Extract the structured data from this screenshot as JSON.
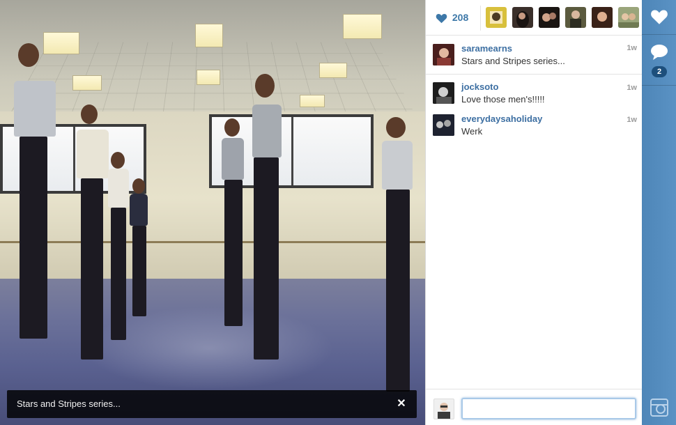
{
  "photo": {
    "caption_overlay": "Stars and Stripes series...",
    "close_glyph": "✕"
  },
  "likes": {
    "count": "208",
    "icon": "heart-icon",
    "color": "#3d78a8",
    "likers": [
      {
        "name": "liker-1",
        "color": "#d8c03c"
      },
      {
        "name": "liker-2",
        "color": "#3a2f2a"
      },
      {
        "name": "liker-3",
        "color": "#2a1e1a"
      },
      {
        "name": "liker-4",
        "color": "#5b5a3e"
      },
      {
        "name": "liker-5",
        "color": "#7a3b2a"
      },
      {
        "name": "liker-6",
        "color": "#9aa57b"
      }
    ]
  },
  "caption": {
    "username": "saramearns",
    "text": "Stars and Stripes series...",
    "time": "1w"
  },
  "comments": [
    {
      "username": "jocksoto",
      "text": "Love those men's!!!!!",
      "time": "1w"
    },
    {
      "username": "everydaysaholiday",
      "text": "Werk",
      "time": "1w"
    }
  ],
  "comment_input": {
    "value": "",
    "placeholder": ""
  },
  "rail": {
    "like_icon": "heart-icon",
    "comment_icon": "speech-bubble-icon",
    "comment_count": "2",
    "camera_icon": "camera-icon",
    "accent": "#4e86b8"
  }
}
